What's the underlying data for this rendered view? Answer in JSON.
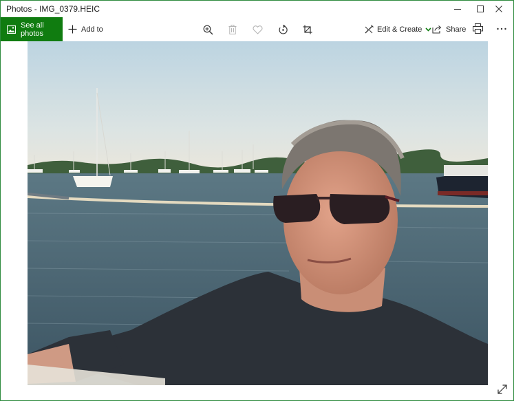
{
  "window": {
    "title": "Photos - IMG_0379.HEIC",
    "controls": {
      "minimize_icon": "minimize-icon",
      "maximize_icon": "maximize-icon",
      "close_icon": "close-icon"
    }
  },
  "toolbar": {
    "see_all_label": "See all photos",
    "add_to_label": "Add to",
    "edit_create_label": "Edit & Create",
    "share_label": "Share",
    "icons": [
      "zoom-in-icon",
      "delete-icon",
      "favorite-icon",
      "rotate-icon",
      "crop-icon",
      "print-icon",
      "more-icon"
    ]
  },
  "colors": {
    "accent": "#107c10",
    "window_border": "#2e8b3e",
    "disabled_icon": "#b5b5b5"
  },
  "photo": {
    "file": "IMG_0379.HEIC"
  }
}
